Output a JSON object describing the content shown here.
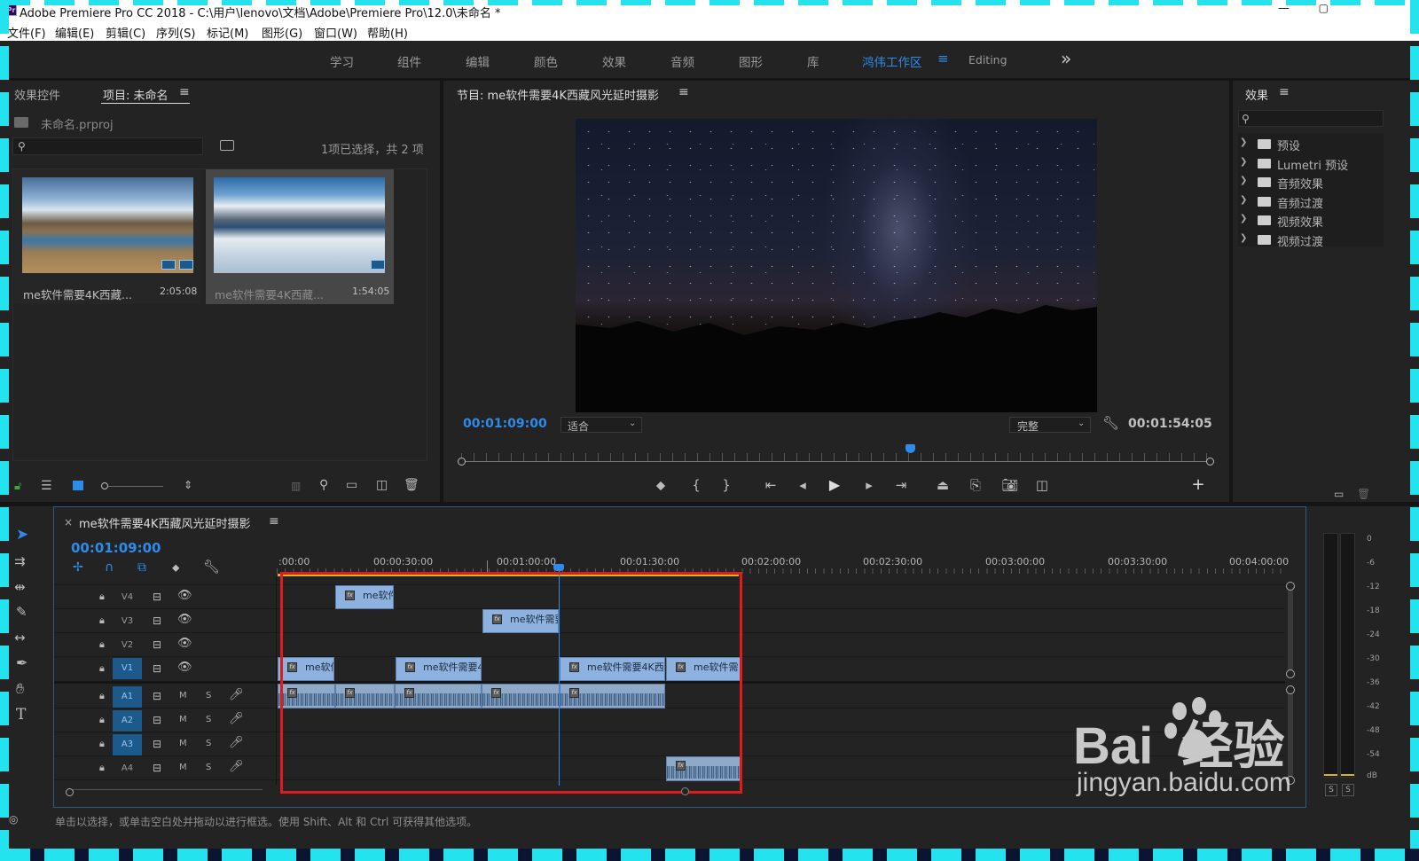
{
  "window": {
    "title": "Adobe Premiere Pro CC 2018 - C:\\用户\\lenovo\\文档\\Adobe\\Premiere Pro\\12.0\\未命名 *",
    "buttons": [
      "—",
      "▢"
    ]
  },
  "menu": [
    "文件(F)",
    "编辑(E)",
    "剪辑(C)",
    "序列(S)",
    "标记(M)",
    "图形(G)",
    "窗口(W)",
    "帮助(H)"
  ],
  "workspaces": {
    "items": [
      "学习",
      "组件",
      "编辑",
      "颜色",
      "效果",
      "音频",
      "图形",
      "库",
      "鸿伟工作区",
      "Editing"
    ],
    "active": "鸿伟工作区",
    "menu_glyph": "≡",
    "more_glyph": "»"
  },
  "project_panel": {
    "tab_effects_controls": "效果控件",
    "tab_project": "项目: 未命名",
    "tab_menu": "≡",
    "project_file": "未命名.prproj",
    "selection_info": "1项已选择，共 2 项",
    "items": [
      {
        "name": "me软件需要4K西藏...",
        "duration": "2:05:08"
      },
      {
        "name": "me软件需要4K西藏...",
        "duration": "1:54:05"
      }
    ]
  },
  "program_monitor": {
    "title": "节目: me软件需要4K西藏风光延时摄影",
    "menu": "≡",
    "timecode_current": "00:01:09:00",
    "fit_select": "适合",
    "quality_select": "完整",
    "timecode_duration": "00:01:54:05"
  },
  "effects_panel": {
    "title": "效果",
    "menu": "≡",
    "items": [
      "预设",
      "Lumetri 预设",
      "音频效果",
      "音频过渡",
      "视频效果",
      "视频过渡"
    ]
  },
  "timeline": {
    "close": "×",
    "sequence_name": "me软件需要4K西藏风光延时摄影",
    "menu": "≡",
    "timecode": "00:01:09:00",
    "ruler": [
      ":00:00",
      "00:00:30:00",
      "00:01:00:00",
      "00:01:30:00",
      "00:02:00:00",
      "00:02:30:00",
      "00:03:00:00",
      "00:03:30:00",
      "00:04:00:00"
    ],
    "video_tracks": [
      "V4",
      "V3",
      "V2",
      "V1"
    ],
    "audio_tracks": [
      "A1",
      "A2",
      "A3",
      "A4"
    ],
    "mute": "M",
    "solo": "S",
    "fx": "fx",
    "clips": {
      "v4": "me软件",
      "v3": "me软件需要",
      "v1_a": "me软件",
      "v1_b": "me软件需要4",
      "v1_c": "me软件需要4K西",
      "v1_d": "me软件需"
    }
  },
  "meters": {
    "ticks": [
      "0",
      "-6",
      "-12",
      "-18",
      "-24",
      "-30",
      "-36",
      "-42",
      "-48",
      "-54",
      "dB"
    ],
    "solo_buttons": [
      "S",
      "S"
    ]
  },
  "status": "单击以选择，或单击空白处并拖动以进行框选。使用 Shift、Alt 和 Ctrl 可获得其他选项。",
  "watermark": {
    "brand": "Bai  经验",
    "url": "jingyan.baidu.com"
  },
  "colors": {
    "accent": "#2d8ceb",
    "highlight": "#e01b1b",
    "frame": "#22e3ee"
  }
}
